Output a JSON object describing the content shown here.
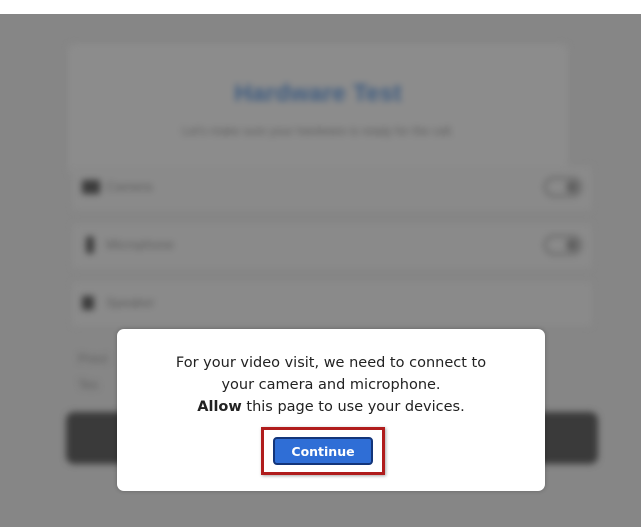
{
  "background": {
    "title": "Hardware Test",
    "subtitle": "Let's make sure your hardware is ready for the call.",
    "rows": [
      {
        "label": "Camera",
        "icon": "camera-icon"
      },
      {
        "label": "Microphone",
        "icon": "microphone-icon"
      },
      {
        "label": "Speaker",
        "icon": "speaker-icon"
      }
    ],
    "side_lines": [
      "Previ",
      "Tes"
    ]
  },
  "dialog": {
    "line1": "For your video visit, we need to connect to",
    "line2": "your camera and microphone.",
    "line3_bold": "Allow",
    "line3_rest": " this page to use your devices.",
    "continue_label": "Continue"
  },
  "colors": {
    "button": "#2f6ed6",
    "highlight": "#b01c1c",
    "overlay": "#868686"
  }
}
